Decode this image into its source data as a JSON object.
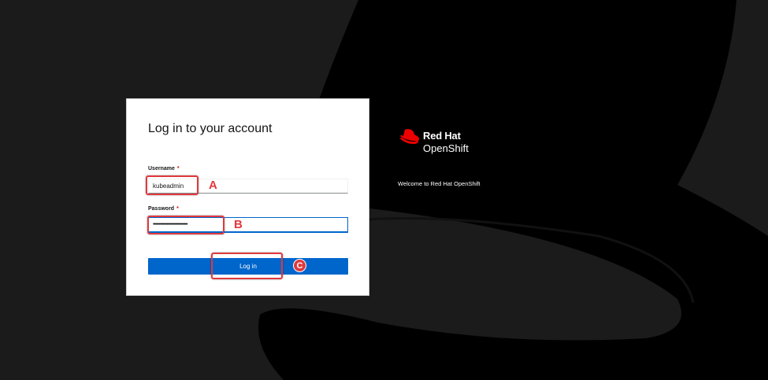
{
  "login": {
    "title": "Log in to your account",
    "username_label": "Username",
    "username_value": "kubeadmin",
    "password_label": "Password",
    "password_value": "••••••••••••••••••••••••••••••",
    "required_marker": "*",
    "submit_label": "Log in"
  },
  "brand": {
    "name": "Red Hat",
    "product": "OpenShift",
    "welcome": "Welcome to Red Hat OpenShift"
  },
  "annotations": {
    "a": "A",
    "b": "B",
    "c": "C"
  },
  "colors": {
    "background": "#1b1b1b",
    "hat": "#000000",
    "brand_red": "#ee0000",
    "primary_button": "#0066cc",
    "annotation": "#e0393e"
  },
  "icons": {
    "brand_logo": "red-hat-logo-icon"
  }
}
